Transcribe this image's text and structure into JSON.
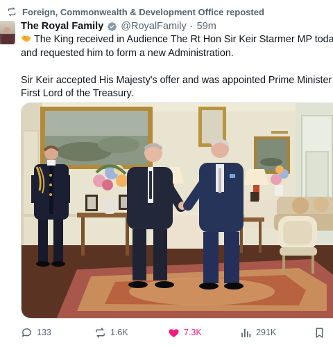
{
  "repost": {
    "text": "Foreign, Commonwealth & Development Office reposted",
    "icon": "repost-icon"
  },
  "author": {
    "name": "The Royal Family",
    "handle": "@RoyalFamily",
    "separator": "·",
    "time": "59m",
    "verified_color": "#829aab"
  },
  "tweet": {
    "line1": "The King received in Audience The Rt Hon Sir Keir Starmer MP today",
    "line2": "and requested him to form a new Administration.",
    "line3": "Sir Keir accepted His Majesty's offer and was appointed Prime Minister and",
    "line4": "First Lord of the Treasury.",
    "emoji": "handshake-emoji"
  },
  "actions": {
    "replies": "133",
    "reposts": "1.6K",
    "likes": "7.3K",
    "views": "291K"
  },
  "colors": {
    "like": "#f91880",
    "secondary": "#536471",
    "text": "#0f1419",
    "border": "#cfd9de"
  }
}
